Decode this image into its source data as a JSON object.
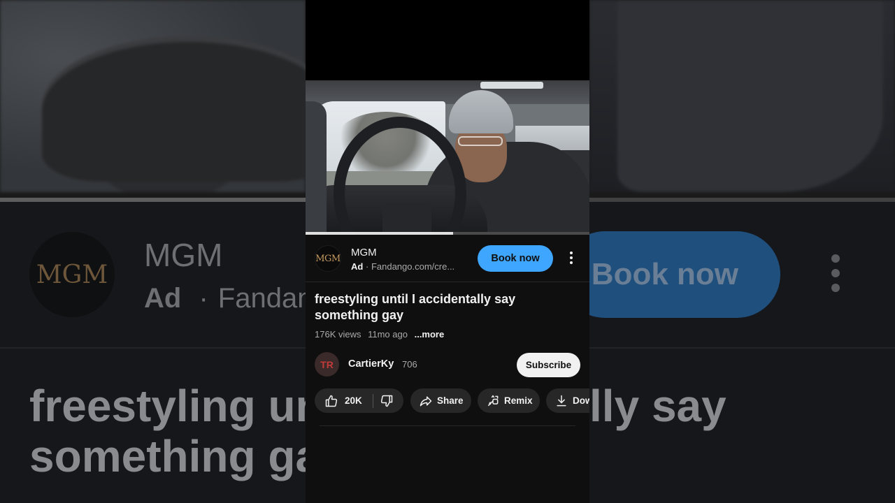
{
  "ad": {
    "logo_text": "MGM",
    "advertiser": "MGM",
    "ad_label": "Ad",
    "separator": "·",
    "domain": "Fandango.com/cre...",
    "cta_label": "Book now",
    "cta_color": "#3ea6ff"
  },
  "video": {
    "title": "freestyling until I accidentally say something gay",
    "views": "176K views",
    "age": "11mo ago",
    "more_label": "...more",
    "progress": 0.52
  },
  "channel": {
    "name": "CartierKy",
    "subscriber_count": "706",
    "subscribe_label": "Subscribe",
    "avatar_text": "TR"
  },
  "actions": {
    "like_count": "20K",
    "share_label": "Share",
    "remix_label": "Remix",
    "download_label": "Dow"
  },
  "background": {
    "logo_text": "MGM",
    "advertiser": "MGM",
    "ad_label": "Ad",
    "separator": "·",
    "domain_fragment": "Fandan",
    "title_line1_left": "freestyling un",
    "title_line2_left": "something ga",
    "title_line1_right": "lly say",
    "cta_label": "Book now"
  }
}
